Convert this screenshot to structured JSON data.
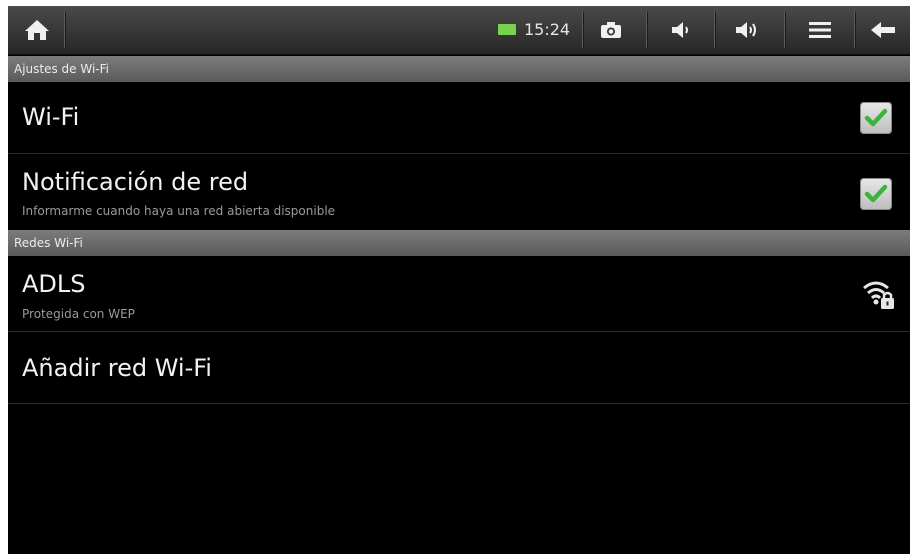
{
  "status_bar": {
    "time": "15:24",
    "icons": [
      "home-icon",
      "battery-icon",
      "camera-icon",
      "volume-down-icon",
      "volume-up-icon",
      "menu-icon",
      "back-icon"
    ],
    "battery_color": "#7ad34a"
  },
  "sections": {
    "wifi_settings_header": "Ajustes de Wi-Fi",
    "networks_header": "Redes Wi-Fi"
  },
  "settings": {
    "wifi": {
      "title": "Wi-Fi",
      "checked": true
    },
    "network_notification": {
      "title": "Notificación de red",
      "subtitle": "Informarme cuando haya una red abierta disponible",
      "checked": true
    }
  },
  "networks": [
    {
      "name": "ADLS",
      "security": "Protegida con WEP",
      "icon": "wifi-lock-icon"
    }
  ],
  "add_network": {
    "label": "Añadir red Wi-Fi"
  },
  "colors": {
    "check_green": "#3cb43c",
    "background": "#000000",
    "header_gray": "#6a6a6a"
  }
}
